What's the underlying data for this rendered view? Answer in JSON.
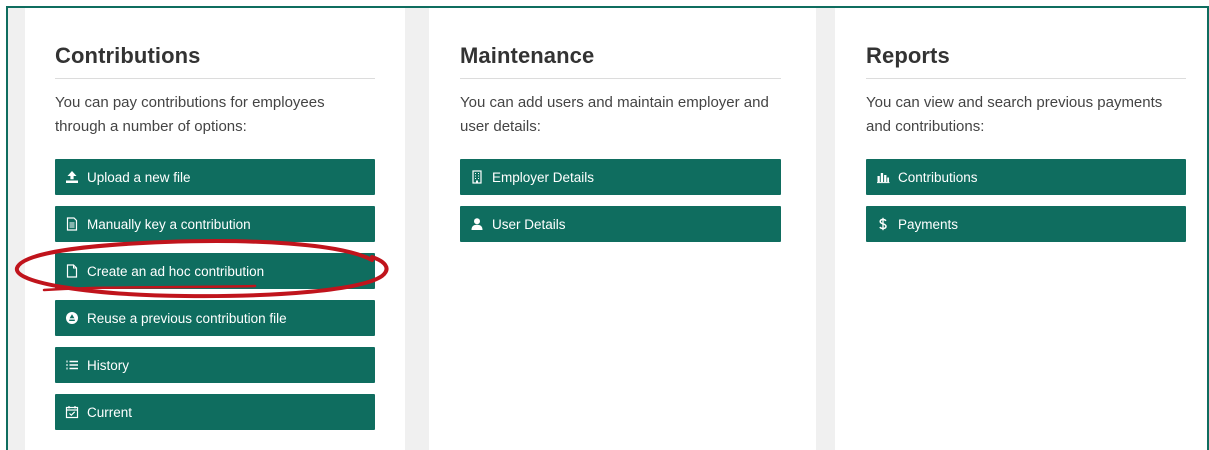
{
  "colors": {
    "accent": "#0f6d5f",
    "annotation": "#c0141c"
  },
  "contributions": {
    "title": "Contributions",
    "description": "You can pay contributions for employees through a number of options:",
    "buttons": [
      {
        "label": "Upload a new file",
        "icon": "upload-icon"
      },
      {
        "label": "Manually key a contribution",
        "icon": "document-lines-icon"
      },
      {
        "label": "Create an ad hoc contribution",
        "icon": "document-blank-icon"
      },
      {
        "label": "Reuse a previous contribution file",
        "icon": "recycle-icon"
      },
      {
        "label": "History",
        "icon": "numbered-list-icon"
      },
      {
        "label": "Current",
        "icon": "calendar-check-icon"
      }
    ]
  },
  "maintenance": {
    "title": "Maintenance",
    "description": "You can add users and maintain employer and user details:",
    "buttons": [
      {
        "label": "Employer Details",
        "icon": "building-icon"
      },
      {
        "label": "User Details",
        "icon": "user-icon"
      }
    ]
  },
  "reports": {
    "title": "Reports",
    "description": "You can view and search previous payments and contributions:",
    "buttons": [
      {
        "label": "Contributions",
        "icon": "bar-chart-icon"
      },
      {
        "label": "Payments",
        "icon": "dollar-icon"
      }
    ]
  }
}
